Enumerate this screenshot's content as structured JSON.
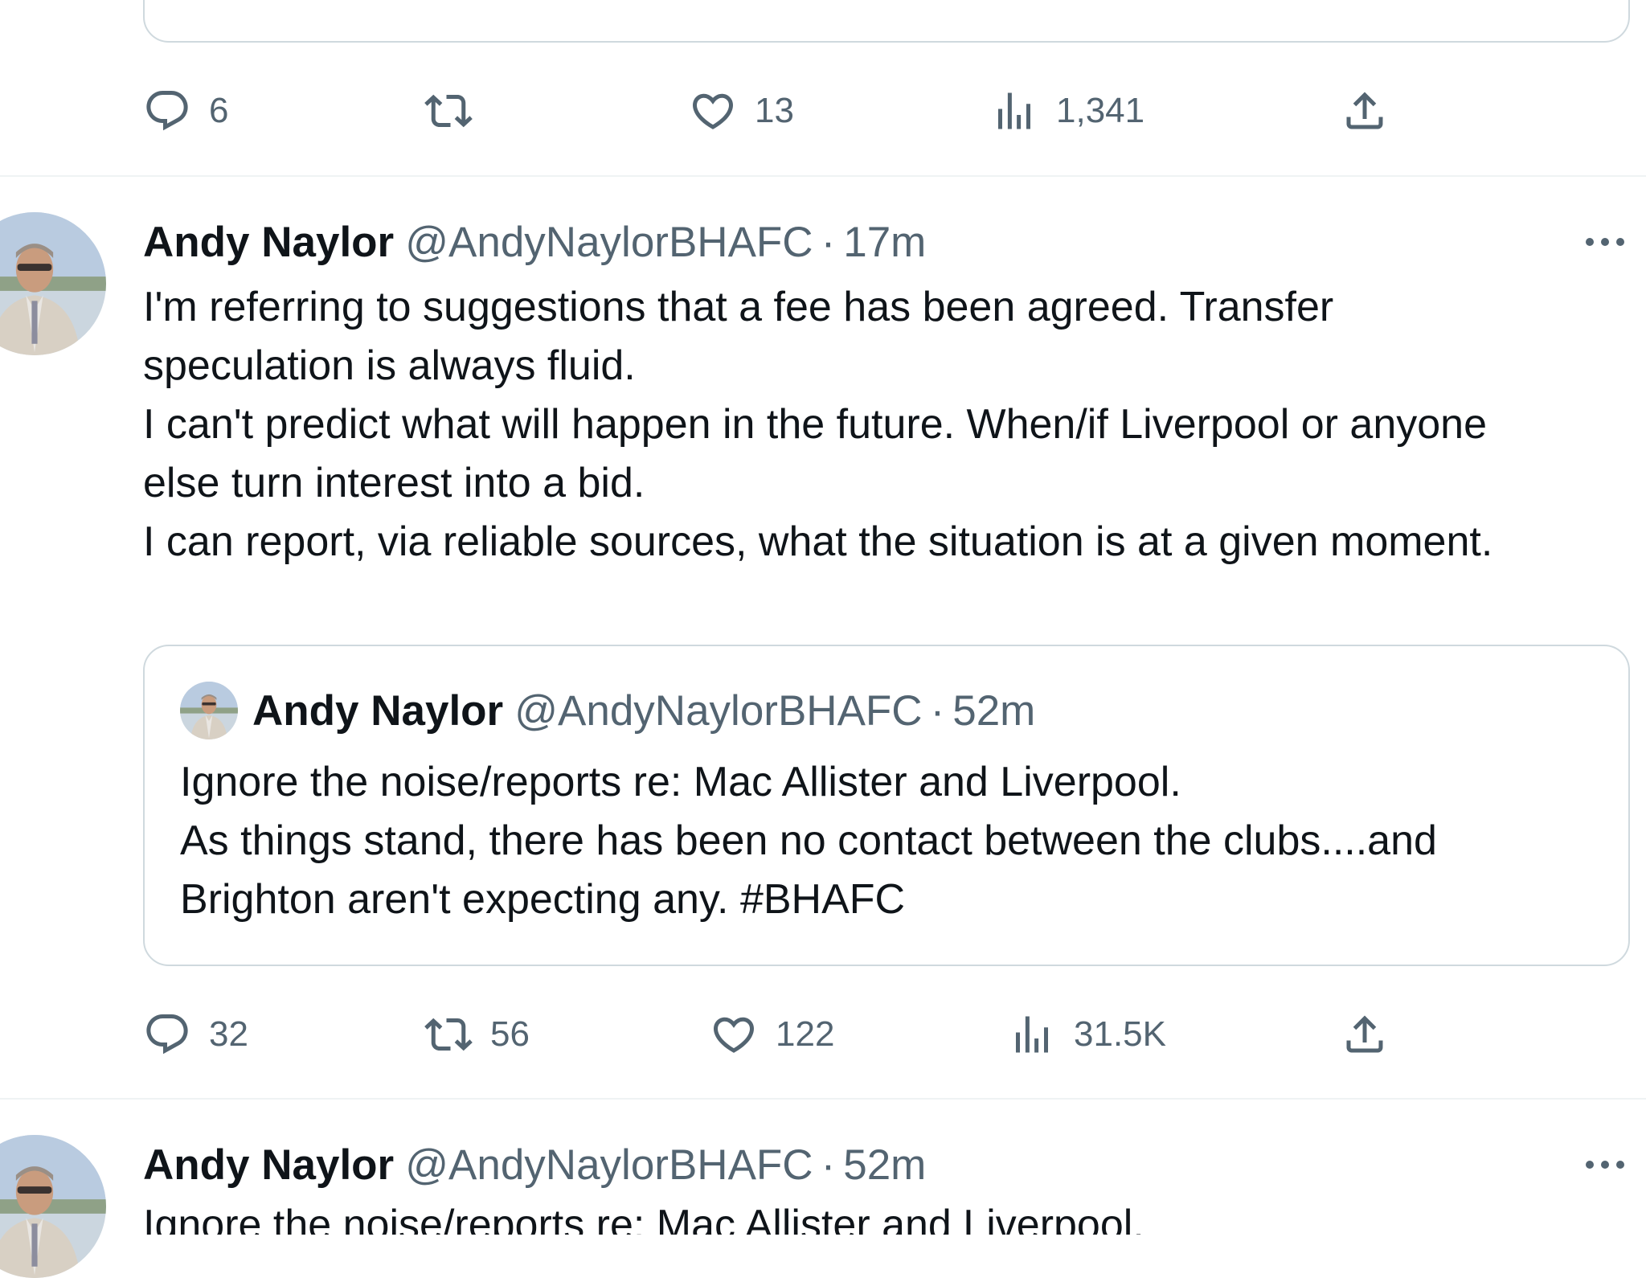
{
  "top_tweet": {
    "actions": {
      "reply_count": "6",
      "retweet_count": "",
      "like_count": "13",
      "views_count": "1,341"
    }
  },
  "tweet": {
    "author_name": "Andy Naylor",
    "author_handle": "@AndyNaylorBHAFC",
    "separator": "·",
    "time": "17m",
    "text_lines": [
      "I'm referring to suggestions that a fee has been agreed. Transfer",
      "speculation is always fluid.",
      "I can't predict what will happen in the future. When/if Liverpool or anyone",
      "else turn interest into a bid.",
      "I can report, via reliable sources, what the situation is at a given moment."
    ],
    "quote": {
      "author_name": "Andy Naylor",
      "author_handle": "@AndyNaylorBHAFC",
      "separator": "·",
      "time": "52m",
      "text_lines": [
        "Ignore the noise/reports re: Mac Allister and Liverpool.",
        "As things stand, there has been no contact between the clubs....and",
        "Brighton aren't expecting any. #BHAFC"
      ]
    },
    "actions": {
      "reply_count": "32",
      "retweet_count": "56",
      "like_count": "122",
      "views_count": "31.5K"
    }
  },
  "next_tweet": {
    "author_name": "Andy Naylor",
    "author_handle": "@AndyNaylorBHAFC",
    "separator": "·",
    "time": "52m",
    "text_first_line": "Ignore the noise/reports re: Mac Allister and Liverpool."
  },
  "icons": {
    "reply": "reply-icon",
    "retweet": "retweet-icon",
    "like": "heart-icon",
    "views": "views-icon",
    "share": "share-icon",
    "more": "more-icon"
  },
  "colors": {
    "text_primary": "#0f1419",
    "text_secondary": "#536471",
    "border": "#cfd9de",
    "divider": "#eff3f4"
  }
}
